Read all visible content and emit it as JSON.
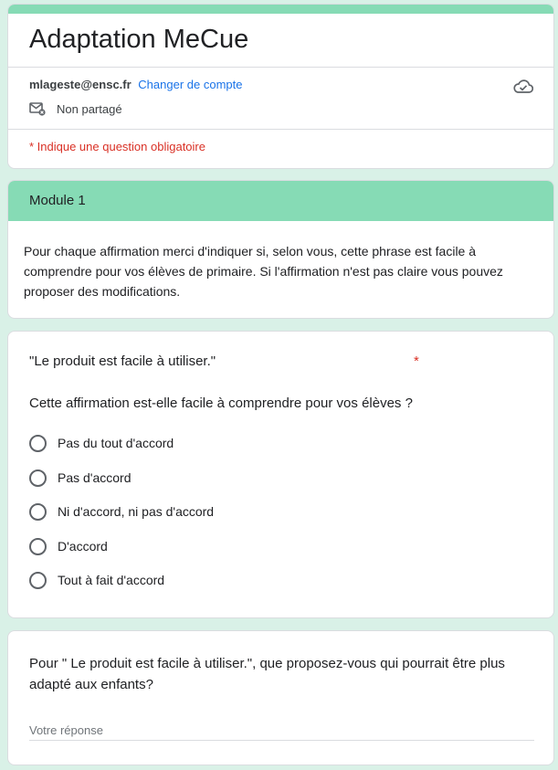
{
  "form": {
    "title": "Adaptation MeCue",
    "account_email": "mlageste@ensc.fr",
    "switch_account": "Changer de compte",
    "sharing": "Non partagé",
    "required_note": "* Indique une question obligatoire"
  },
  "section": {
    "title": "Module 1",
    "description": "Pour chaque affirmation merci d'indiquer si, selon vous, cette phrase est facile à comprendre pour vos élèves de primaire. Si l'affirmation n'est pas claire vous pouvez proposer des modifications."
  },
  "question": {
    "title": "\"Le produit est facile à utiliser.\"",
    "required_mark": "*",
    "subtitle": "Cette affirmation est-elle facile à comprendre pour vos élèves ?",
    "options": [
      "Pas du tout d'accord",
      "Pas d'accord",
      "Ni d'accord, ni pas d'accord",
      "D'accord",
      "Tout à fait d'accord"
    ]
  },
  "text_question": {
    "title": "Pour \" Le produit est facile à utiliser.\", que proposez-vous qui pourrait être plus adapté aux enfants?",
    "placeholder": "Votre réponse",
    "value": ""
  },
  "icons": {
    "cloud": "cloud-saved-icon",
    "mail": "mail-not-shared-icon",
    "radio": "radio-unchecked-icon"
  },
  "colors": {
    "accent": "#86dbb5",
    "background": "#d9f1e7",
    "link": "#1a73e8",
    "required": "#d93025"
  }
}
